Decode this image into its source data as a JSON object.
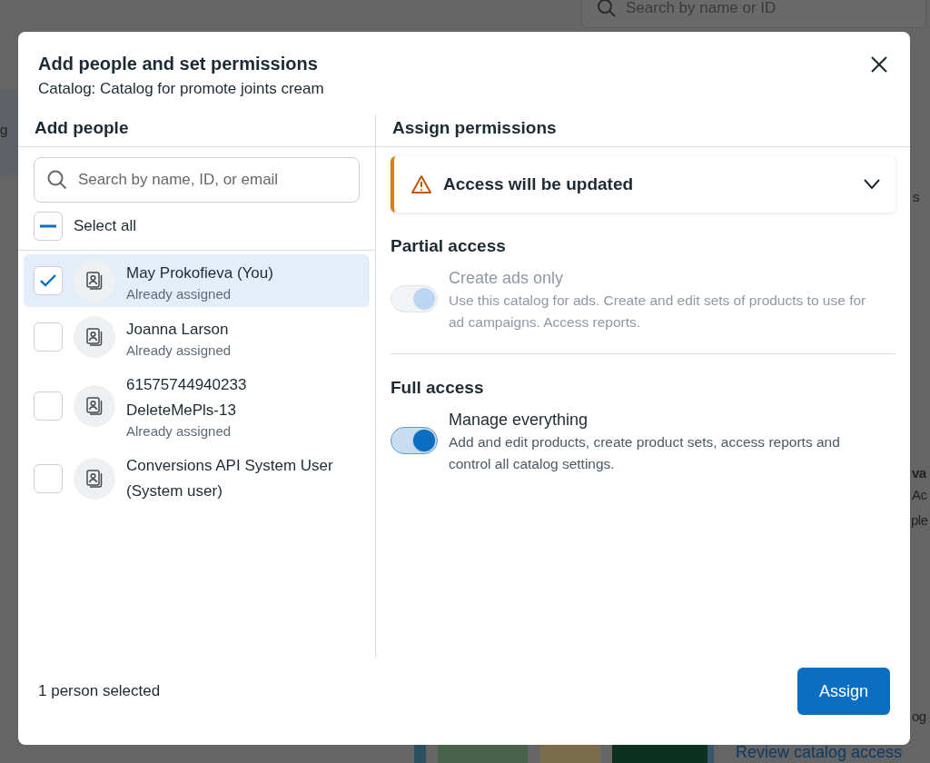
{
  "background": {
    "search": {
      "placeholder": "Search by name or ID"
    },
    "link": "Review catalog access",
    "fragments": [
      {
        "kind": "left",
        "text": "g"
      },
      {
        "kind": "tab",
        "text": "s"
      },
      {
        "kind": "title",
        "text": "va"
      },
      {
        "kind": "line",
        "text": "Ac"
      },
      {
        "kind": "line",
        "text": "ple"
      },
      {
        "kind": "line",
        "text": "og"
      }
    ]
  },
  "dialog": {
    "title": "Add people and set permissions",
    "subtitle": "Catalog: Catalog for promote joints cream",
    "people": {
      "heading": "Add people",
      "search": {
        "placeholder": "Search by name, ID, or email"
      },
      "select_all": {
        "label": "Select all",
        "indeterminate": true
      },
      "items": [
        {
          "name": "May Prokofieva (You)",
          "status": "Already assigned",
          "checked": true,
          "selected": true
        },
        {
          "name": "Joanna Larson",
          "status": "Already assigned",
          "checked": false,
          "selected": false
        },
        {
          "name": "61575744940233 DeleteMePls-13",
          "status": "Already assigned",
          "checked": false,
          "selected": false
        },
        {
          "name": "Conversions API System User (System user)",
          "checked": false,
          "selected": false
        }
      ]
    },
    "permissions": {
      "heading": "Assign permissions",
      "notice": {
        "text": "Access will be updated",
        "expanded": false
      },
      "sections": [
        {
          "title": "Partial access",
          "options": [
            {
              "label": "Create ads only",
              "description": "Use this catalog for ads. Create and edit sets of products to use for ad campaigns. Access reports.",
              "on": true,
              "disabled": true
            }
          ]
        },
        {
          "title": "Full access",
          "options": [
            {
              "label": "Manage everything",
              "description": "Add and edit products, create product sets, access reports and control all catalog settings.",
              "on": true,
              "disabled": false
            }
          ]
        }
      ]
    },
    "footer": {
      "count": "1 person selected",
      "button": "Assign"
    }
  }
}
